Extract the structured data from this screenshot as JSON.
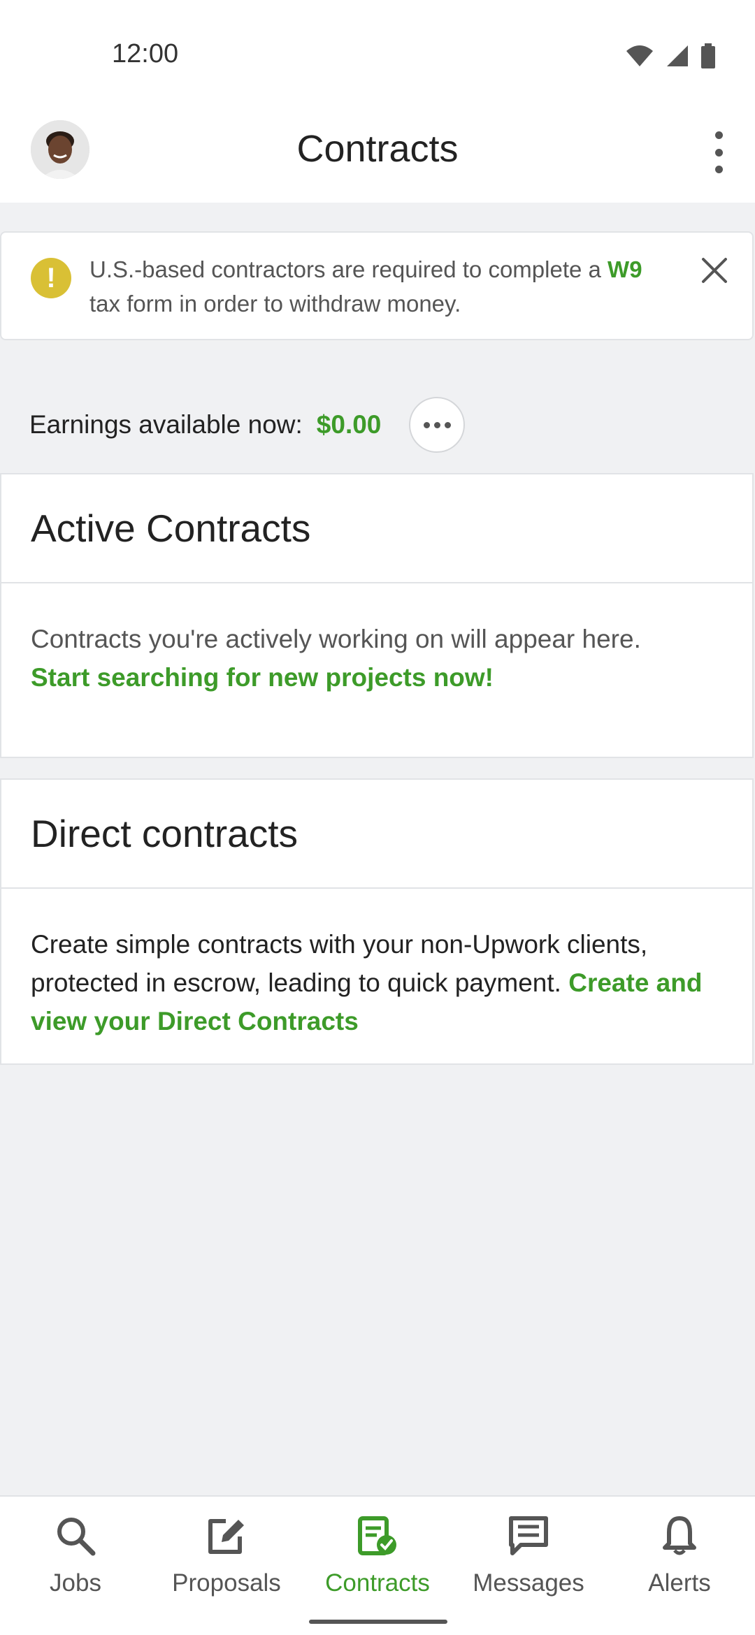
{
  "status": {
    "time": "12:00"
  },
  "header": {
    "title": "Contracts"
  },
  "banner": {
    "text_before": "U.S.-based contractors are required to complete a ",
    "link": "W9",
    "text_after": " tax form in order to withdraw money."
  },
  "earnings": {
    "label": "Earnings available now:",
    "amount": "$0.00"
  },
  "active_contracts": {
    "title": "Active Contracts",
    "text": "Contracts you're actively working on will appear here.",
    "link": "Start searching for new projects now!"
  },
  "direct_contracts": {
    "title": "Direct contracts",
    "text": "Create simple contracts with your non-Upwork clients, protected in escrow, leading to quick payment. ",
    "link": "Create and view your Direct Contracts"
  },
  "nav": {
    "items": [
      {
        "label": "Jobs",
        "icon": "search-icon"
      },
      {
        "label": "Proposals",
        "icon": "edit-icon"
      },
      {
        "label": "Contracts",
        "icon": "contract-check-icon",
        "active": true
      },
      {
        "label": "Messages",
        "icon": "message-icon"
      },
      {
        "label": "Alerts",
        "icon": "bell-icon"
      }
    ]
  },
  "colors": {
    "accent": "#3d9b29",
    "warning": "#d9c035",
    "background": "#f0f1f3"
  }
}
